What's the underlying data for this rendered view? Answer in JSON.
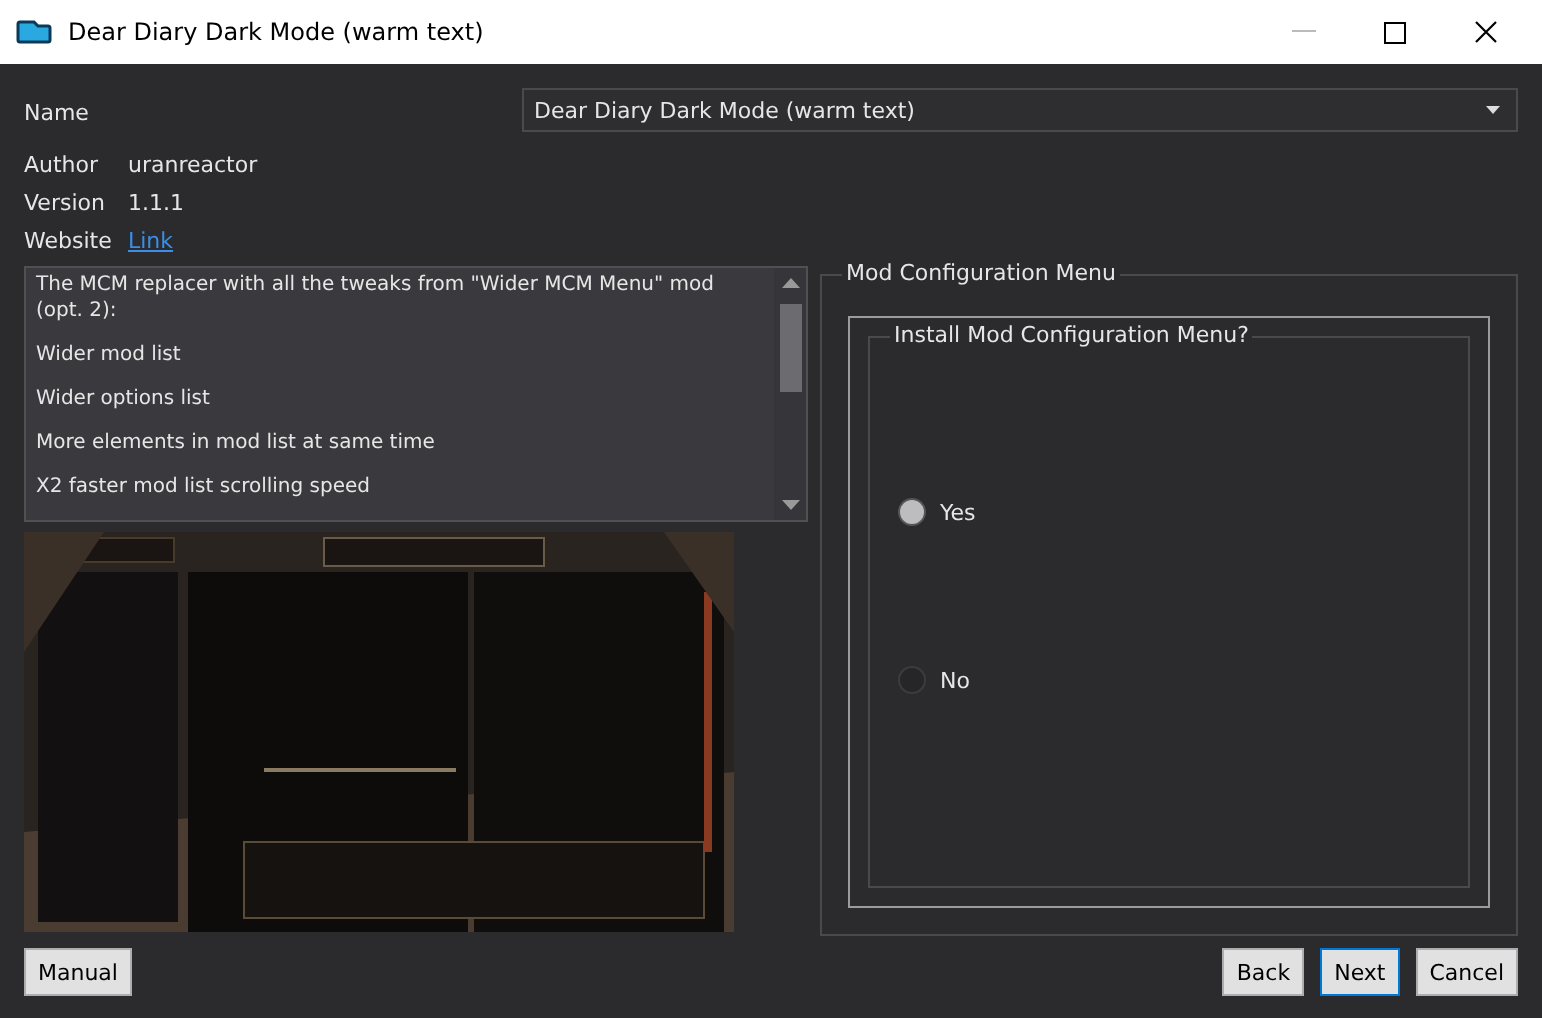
{
  "window": {
    "title": "Dear Diary Dark Mode (warm text)"
  },
  "name": {
    "label": "Name",
    "value": "Dear Diary Dark Mode (warm text)"
  },
  "info": [
    {
      "label": "Author",
      "value": "uranreactor",
      "kind": "text"
    },
    {
      "label": "Version",
      "value": "1.1.1",
      "kind": "text"
    },
    {
      "label": "Website",
      "value": "Link",
      "kind": "link"
    }
  ],
  "description": [
    "The MCM replacer with all the tweaks from \"Wider MCM Menu\" mod (opt. 2):",
    "Wider mod list",
    "Wider options list",
    "More elements in mod list at same time",
    "X2 faster mod list scrolling speed"
  ],
  "group": {
    "title": "Mod Configuration Menu",
    "question": "Install Mod Configuration Menu?",
    "options": [
      {
        "label": "Yes",
        "selected": true
      },
      {
        "label": "No",
        "selected": false
      }
    ]
  },
  "buttons": {
    "manual": "Manual",
    "back": "Back",
    "next": "Next",
    "cancel": "Cancel"
  }
}
